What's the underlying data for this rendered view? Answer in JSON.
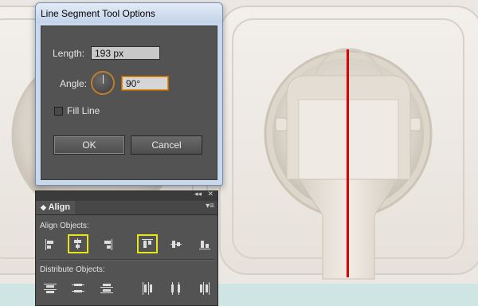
{
  "dialog": {
    "title": "Line Segment Tool Options",
    "length_label": "Length:",
    "length_value": "193 px",
    "angle_label": "Angle:",
    "angle_value": "90°",
    "fill_line_label": "Fill Line",
    "fill_line_checked": false,
    "ok_label": "OK",
    "cancel_label": "Cancel"
  },
  "align_panel": {
    "tab_label": "Align",
    "align_objects_label": "Align Objects:",
    "distribute_objects_label": "Distribute Objects:",
    "align_buttons": [
      {
        "name": "horizontal-align-left",
        "icon": "align-left-icon",
        "highlighted": false
      },
      {
        "name": "horizontal-align-center",
        "icon": "align-hcenter-icon",
        "highlighted": true
      },
      {
        "name": "horizontal-align-right",
        "icon": "align-right-icon",
        "highlighted": false
      },
      {
        "name": "vertical-align-top",
        "icon": "align-top-icon",
        "highlighted": true
      },
      {
        "name": "vertical-align-center",
        "icon": "align-vcenter-icon",
        "highlighted": false
      },
      {
        "name": "vertical-align-bottom",
        "icon": "align-bottom-icon",
        "highlighted": false
      }
    ],
    "distribute_buttons": [
      {
        "name": "vertical-distribute-top",
        "icon": "distribute-top-icon"
      },
      {
        "name": "vertical-distribute-center",
        "icon": "distribute-vcenter-icon"
      },
      {
        "name": "vertical-distribute-bottom",
        "icon": "distribute-bottom-icon"
      },
      {
        "name": "horizontal-distribute-left",
        "icon": "distribute-left-icon"
      },
      {
        "name": "horizontal-distribute-center",
        "icon": "distribute-hcenter-icon"
      },
      {
        "name": "horizontal-distribute-right",
        "icon": "distribute-right-icon"
      }
    ]
  },
  "colors": {
    "highlight": "#e5e51a",
    "guide_line": "#e00000",
    "focus_ring": "#e08a1e"
  }
}
